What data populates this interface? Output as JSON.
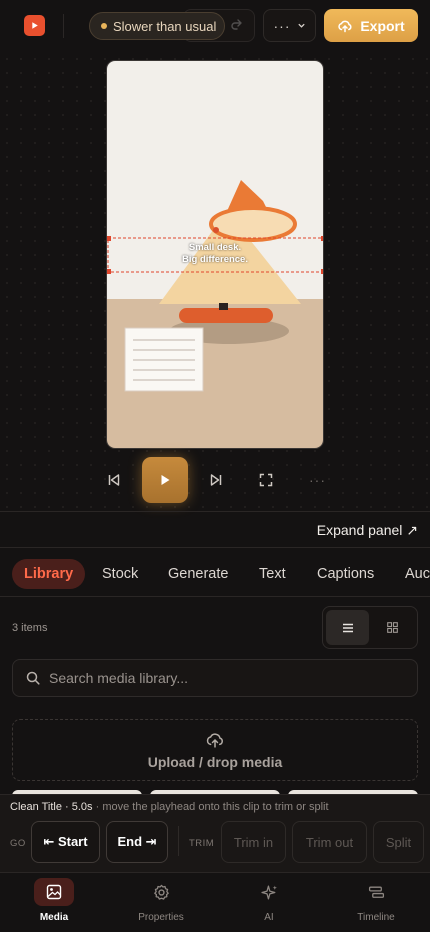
{
  "topbar": {
    "status_label": "Slower than usual",
    "export_label": "Export",
    "colors": {
      "accent": "#e8a94e",
      "brand": "#e9502e"
    }
  },
  "preview": {
    "caption_line1": "Small desk.",
    "caption_line2": "Big difference."
  },
  "panel": {
    "expand_label": "Expand panel ↗"
  },
  "tabs": [
    {
      "label": "Library",
      "active": true
    },
    {
      "label": "Stock"
    },
    {
      "label": "Generate"
    },
    {
      "label": "Text"
    },
    {
      "label": "Captions"
    },
    {
      "label": "Auc"
    }
  ],
  "library": {
    "items_count": "3 items",
    "search_placeholder": "Search media library...",
    "upload_label": "Upload / drop media"
  },
  "trim": {
    "clip_name": "Clean Title · 5.0s",
    "clip_hint": " · move the playhead onto this clip to trim or split",
    "go_label": "GO",
    "start_label": "⇤ Start",
    "end_label": "End ⇥",
    "trim_label": "TRIM",
    "trim_in_label": "Trim in",
    "trim_out_label": "Trim out",
    "split_label": "Split"
  },
  "bottom_nav": [
    {
      "label": "Media",
      "icon": "image-icon",
      "active": true
    },
    {
      "label": "Properties",
      "icon": "gear-icon"
    },
    {
      "label": "AI",
      "icon": "sparkle-icon"
    },
    {
      "label": "Timeline",
      "icon": "timeline-icon"
    }
  ]
}
